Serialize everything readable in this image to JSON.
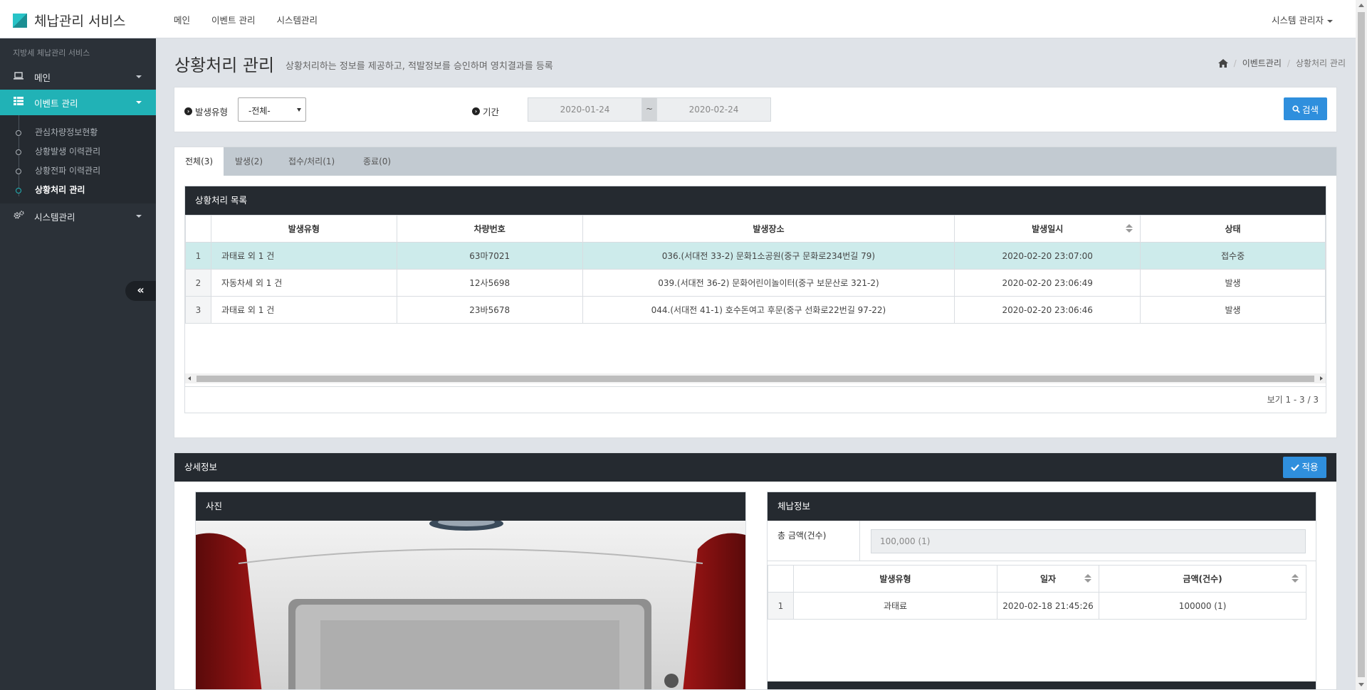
{
  "app": {
    "title": "체납관리 서비스"
  },
  "topnav": {
    "items": [
      "메인",
      "이벤트 관리",
      "시스템관리"
    ],
    "user": "시스템 관리자"
  },
  "sidebar": {
    "subtitle": "지방세 체납관리 서비스",
    "items": [
      {
        "label": "메인",
        "icon": "laptop-icon"
      },
      {
        "label": "이벤트 관리",
        "icon": "grid-icon",
        "active": true
      },
      {
        "label": "시스템관리",
        "icon": "cogs-icon"
      }
    ],
    "children": [
      "관심차량정보현황",
      "상황발생 이력관리",
      "상황전파 이력관리",
      "상황처리 관리"
    ],
    "current_child": "상황처리 관리"
  },
  "page": {
    "title": "상황처리 관리",
    "description": "상황처리하는 정보를 제공하고, 적발정보를 승인하며 영치결과를 등록",
    "breadcrumb": [
      "이벤트관리",
      "상황처리 관리"
    ]
  },
  "search": {
    "type_label": "발생유형",
    "type_value": "-전체-",
    "period_label": "기간",
    "date_from": "2020-01-24",
    "date_sep": "~",
    "date_to": "2020-02-24",
    "button": "검색"
  },
  "tabs": [
    "전체(3)",
    "발생(2)",
    "접수/처리(1)",
    "종료(0)"
  ],
  "list": {
    "caption": "상황처리 목록",
    "columns": [
      "발생유형",
      "차량번호",
      "발생장소",
      "발생일시",
      "상태"
    ],
    "rows": [
      {
        "no": "1",
        "type": "과태료 외 1 건",
        "plate": "63마7021",
        "place": "036.(서대전 33-2) 문화1소공원(중구 문화로234번길 79)",
        "time": "2020-02-20 23:07:00",
        "status": "접수중"
      },
      {
        "no": "2",
        "type": "자동차세 외 1 건",
        "plate": "12사5698",
        "place": "039.(서대전 36-2) 문화어린이놀이터(중구 보문산로 321-2)",
        "time": "2020-02-20 23:06:49",
        "status": "발생"
      },
      {
        "no": "3",
        "type": "과태료 외 1 건",
        "plate": "23바5678",
        "place": "044.(서대전 41-1) 호수돈여고 후문(중구 선화로22번길 97-22)",
        "time": "2020-02-20 23:06:46",
        "status": "발생"
      }
    ],
    "pager": "보기 1 - 3 / 3"
  },
  "detail": {
    "title": "상세정보",
    "apply_button": "적용",
    "photo_title": "사진",
    "arrears_title": "체납정보",
    "total_label": "총 금액(건수)",
    "total_value": "100,000 (1)",
    "columns": [
      "발생유형",
      "일자",
      "금액(건수)"
    ],
    "rows": [
      {
        "no": "1",
        "type": "과태료",
        "date": "2020-02-18 21:45:26",
        "amount": "100000 (1)"
      }
    ]
  },
  "colors": {
    "accent": "#21b2b6",
    "sidebar": "#2b3138",
    "primary_button": "#2f8fdd",
    "header_dark": "#252a30"
  }
}
